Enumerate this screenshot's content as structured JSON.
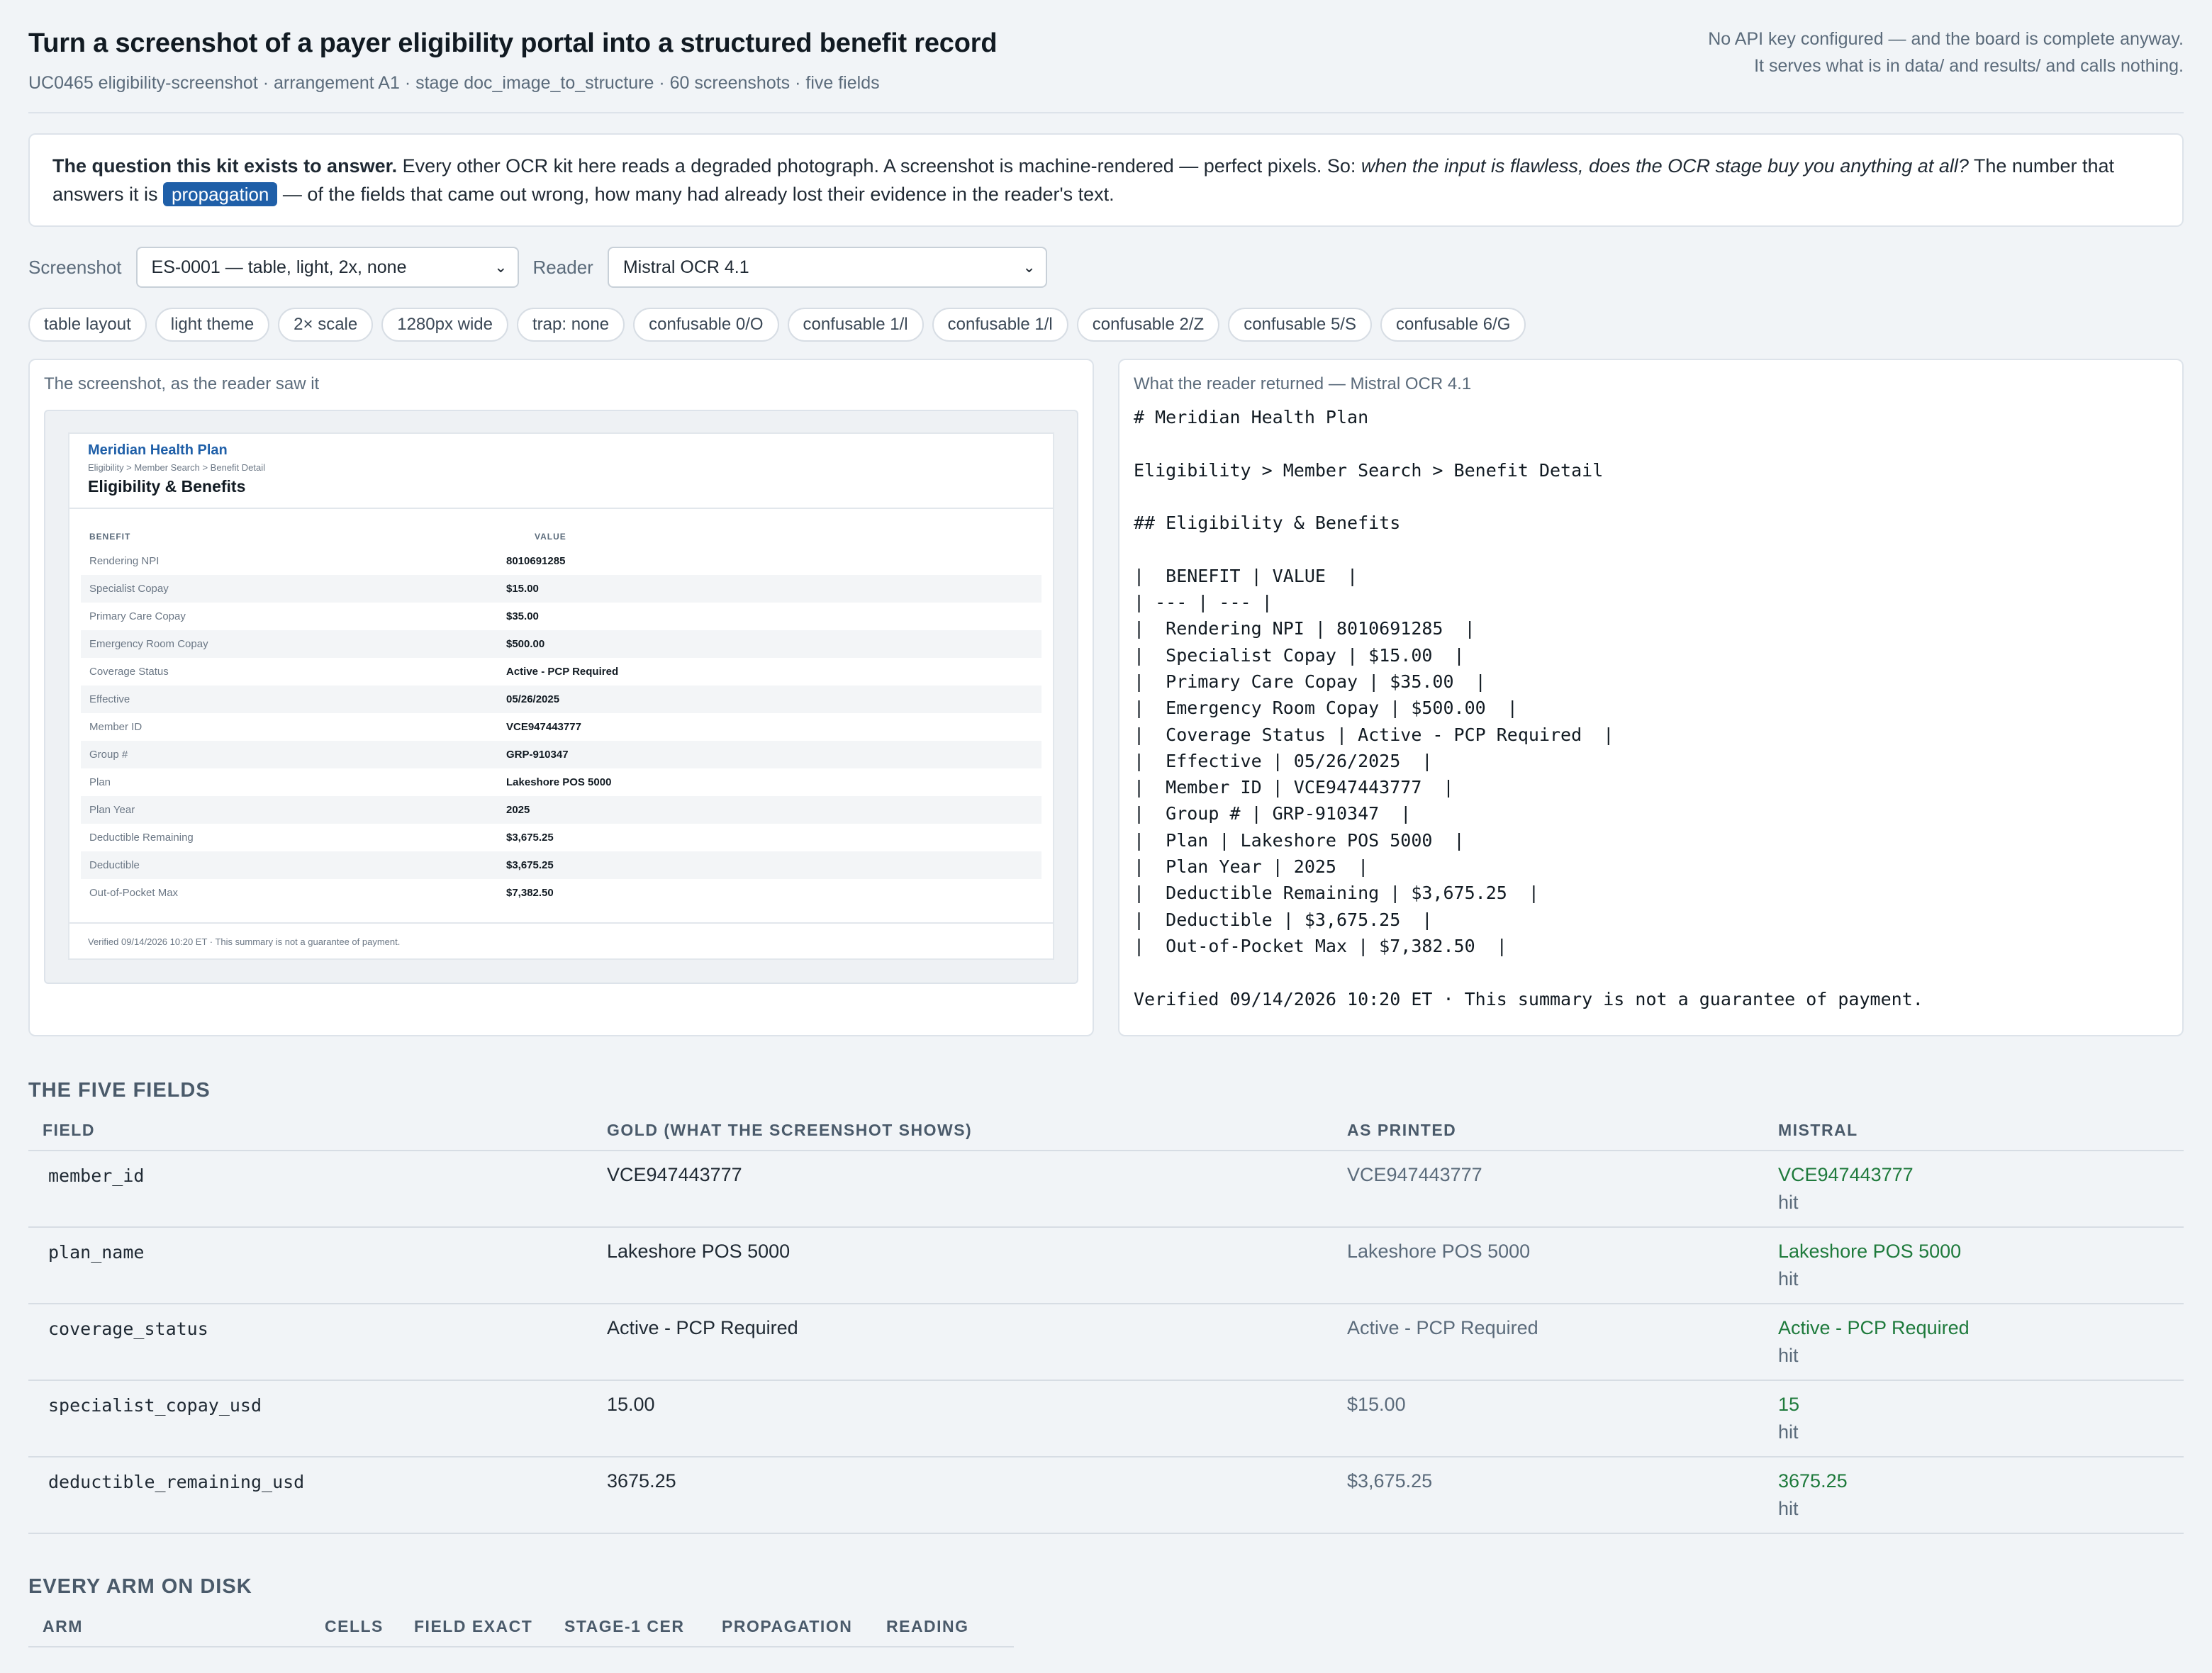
{
  "header": {
    "title": "Turn a screenshot of a payer eligibility portal into a structured benefit record",
    "subtitle": "UC0465 eligibility-screenshot · arrangement A1 · stage doc_image_to_structure · 60 screenshots · five fields",
    "note_line1": "No API key configured — and the board is complete anyway.",
    "note_line2": "It serves what is in data/ and results/ and calls nothing."
  },
  "question": {
    "lead": "The question this kit exists to answer.",
    "text1": " Every other OCR kit here reads a degraded photograph. A screenshot is machine-rendered — perfect pixels. So: ",
    "italic": "when the input is flawless, does the OCR stage buy you anything at all?",
    "text2": " The number that answers it is ",
    "pill": "propagation",
    "text3": " — of the fields that came out wrong, how many had already lost their evidence in the reader's text."
  },
  "selectors": {
    "screenshot_label": "Screenshot",
    "screenshot_value": "ES-0001 — table, light, 2x, none",
    "reader_label": "Reader",
    "reader_value": "Mistral OCR 4.1"
  },
  "tags": [
    "table layout",
    "light theme",
    "2× scale",
    "1280px wide",
    "trap: none",
    "confusable 0/O",
    "confusable 1/l",
    "confusable 1/l",
    "confusable 2/Z",
    "confusable 5/S",
    "confusable 6/G"
  ],
  "left_panel": {
    "title": "The screenshot, as the reader saw it",
    "brand": "Meridian Health Plan",
    "crumb": "Eligibility > Member Search > Benefit Detail",
    "page_title": "Eligibility & Benefits",
    "col1": "BENEFIT",
    "col2": "VALUE",
    "rows": [
      {
        "k": "Rendering NPI",
        "v": "8010691285"
      },
      {
        "k": "Specialist Copay",
        "v": "$15.00"
      },
      {
        "k": "Primary Care Copay",
        "v": "$35.00"
      },
      {
        "k": "Emergency Room Copay",
        "v": "$500.00"
      },
      {
        "k": "Coverage Status",
        "v": "Active - PCP Required"
      },
      {
        "k": "Effective",
        "v": "05/26/2025"
      },
      {
        "k": "Member ID",
        "v": "VCE947443777"
      },
      {
        "k": "Group #",
        "v": "GRP-910347"
      },
      {
        "k": "Plan",
        "v": "Lakeshore POS 5000"
      },
      {
        "k": "Plan Year",
        "v": "2025"
      },
      {
        "k": "Deductible Remaining",
        "v": "$3,675.25"
      },
      {
        "k": "Deductible",
        "v": "$3,675.25"
      },
      {
        "k": "Out-of-Pocket Max",
        "v": "$7,382.50"
      }
    ],
    "footer": "Verified 09/14/2026 10:20 ET · This summary is not a guarantee of payment."
  },
  "right_panel": {
    "title": "What the reader returned — Mistral OCR 4.1",
    "ocr_lines": [
      "# Meridian Health Plan",
      "",
      "Eligibility > Member Search > Benefit Detail",
      "",
      "## Eligibility & Benefits",
      "",
      "|  BENEFIT | VALUE  |",
      "| --- | --- |",
      "|  Rendering NPI | 8010691285  |",
      "|  Specialist Copay | $15.00  |",
      "|  Primary Care Copay | $35.00  |",
      "|  Emergency Room Copay | $500.00  |",
      "|  Coverage Status | Active - PCP Required  |",
      "|  Effective | 05/26/2025  |",
      "|  Member ID | VCE947443777  |",
      "|  Group # | GRP-910347  |",
      "|  Plan | Lakeshore POS 5000  |",
      "|  Plan Year | 2025  |",
      "|  Deductible Remaining | $3,675.25  |",
      "|  Deductible | $3,675.25  |",
      "|  Out-of-Pocket Max | $7,382.50  |",
      "",
      "Verified 09/14/2026 10:20 ET · This summary is not a guarantee of payment."
    ]
  },
  "five_fields": {
    "heading": "THE FIVE FIELDS",
    "columns": [
      "FIELD",
      "GOLD (WHAT THE SCREENSHOT SHOWS)",
      "AS PRINTED",
      "MISTRAL"
    ],
    "rows": [
      {
        "field": "member_id",
        "gold": "VCE947443777",
        "printed": "VCE947443777",
        "value": "VCE947443777",
        "status": "hit"
      },
      {
        "field": "plan_name",
        "gold": "Lakeshore POS 5000",
        "printed": "Lakeshore POS 5000",
        "value": "Lakeshore POS 5000",
        "status": "hit"
      },
      {
        "field": "coverage_status",
        "gold": "Active - PCP Required",
        "printed": "Active - PCP Required",
        "value": "Active - PCP Required",
        "status": "hit"
      },
      {
        "field": "specialist_copay_usd",
        "gold": "15.00",
        "printed": "$15.00",
        "value": "15",
        "status": "hit"
      },
      {
        "field": "deductible_remaining_usd",
        "gold": "3675.25",
        "printed": "$3,675.25",
        "value": "3675.25",
        "status": "hit"
      }
    ]
  },
  "arms": {
    "heading": "EVERY ARM ON DISK",
    "columns": [
      "ARM",
      "CELLS",
      "FIELD EXACT",
      "STAGE-1 CER",
      "PROPAGATION",
      "READING"
    ]
  },
  "colors": {
    "accent": "#1f5fa8",
    "hit": "#1e7a3c",
    "background": "#f1f4f7"
  }
}
